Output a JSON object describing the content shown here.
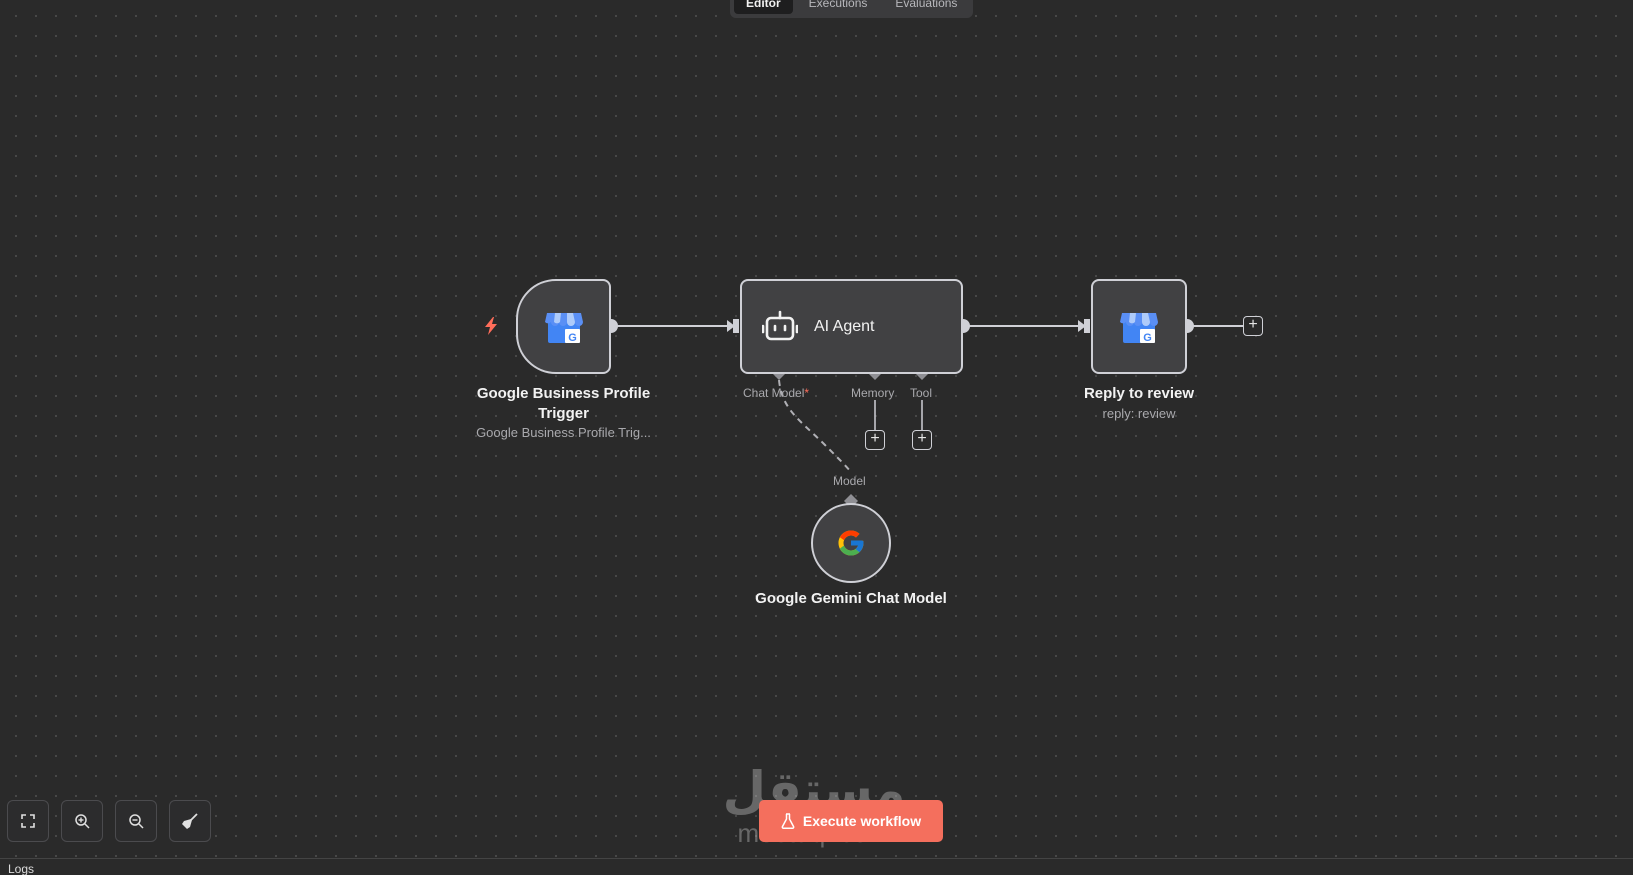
{
  "tabs": [
    {
      "label": "Editor",
      "active": true
    },
    {
      "label": "Executions",
      "active": false
    },
    {
      "label": "Evaluations",
      "active": false
    }
  ],
  "nodes": {
    "trigger": {
      "title": "Google Business Profile Trigger",
      "subtitle": "Google Business Profile Trig...",
      "icon": "google-business-profile-icon"
    },
    "agent": {
      "title": "AI Agent",
      "icon": "robot-icon"
    },
    "reply": {
      "title": "Reply to review",
      "subtitle": "reply: review",
      "icon": "google-business-profile-icon"
    },
    "gemini": {
      "title": "Google Gemini Chat Model",
      "icon": "google-g-icon"
    }
  },
  "ports": {
    "chat_model": "Chat Model",
    "chat_model_required": "*",
    "memory": "Memory",
    "tool": "Tool",
    "model": "Model"
  },
  "controls": {
    "execute_label": "Execute workflow",
    "zoom_fit_icon": "fit-view-icon",
    "zoom_in_icon": "zoom-in-icon",
    "zoom_out_icon": "zoom-out-icon",
    "tidy_icon": "broom-icon"
  },
  "watermark": {
    "arabic": "مستقل",
    "latin": "mostaql.com"
  },
  "logs": {
    "label": "Logs"
  },
  "colors": {
    "accent": "#f46f5d",
    "canvas": "#2a2a2a",
    "node": "#414143",
    "border": "#cfd0d6"
  }
}
